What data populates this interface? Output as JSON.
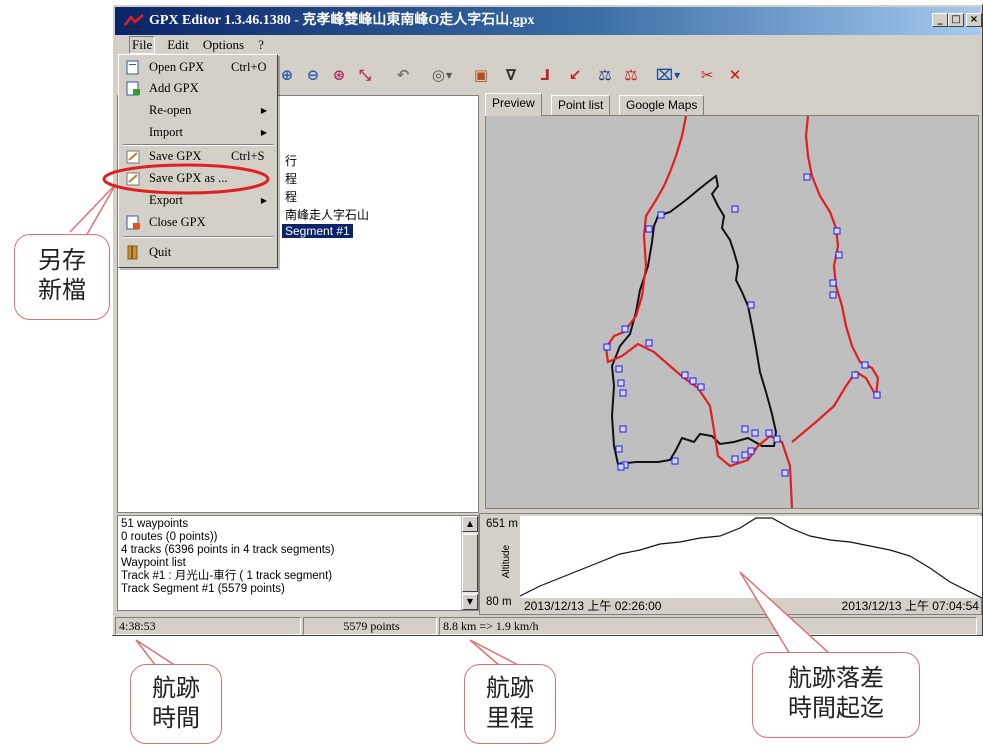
{
  "window": {
    "title": "GPX Editor 1.3.46.1380 - 克孝峰雙峰山東南峰O走人字石山.gpx",
    "controls": [
      "_",
      "□",
      "×"
    ]
  },
  "menubar": {
    "items": [
      "File",
      "Edit",
      "Options",
      "?"
    ]
  },
  "file_menu": {
    "items": [
      {
        "label": "Open GPX",
        "shortcut": "Ctrl+O",
        "icon": "open-file-icon"
      },
      {
        "label": "Add GPX",
        "shortcut": "",
        "icon": "add-file-icon"
      },
      {
        "label": "Re-open",
        "submenu": true
      },
      {
        "label": "Import",
        "submenu": true
      },
      {
        "label": "Save GPX",
        "shortcut": "Ctrl+S",
        "icon": "save-icon"
      },
      {
        "label": "Save GPX as ...",
        "shortcut": "",
        "icon": "save-as-icon"
      },
      {
        "label": "Export",
        "submenu": true
      },
      {
        "label": "Close GPX",
        "shortcut": "",
        "icon": "close-file-icon"
      },
      {
        "label": "Quit",
        "shortcut": "",
        "icon": "quit-icon"
      }
    ],
    "submenu_arrow": "▶"
  },
  "tree": {
    "items": [
      "行",
      "程",
      "程",
      "南峰走人字石山",
      "Segment #1"
    ]
  },
  "tabs": [
    "Preview",
    "Point list",
    "Google Maps"
  ],
  "info": {
    "lines": [
      "51 waypoints",
      "0 routes (0 points))",
      "4 tracks (6396 points in 4 track segments)",
      "Waypoint list",
      "Track #1 : 月光山-車行 ( 1 track segment)",
      "Track Segment #1 (5579 points)"
    ]
  },
  "altitude": {
    "max_label": "651 m",
    "min_label": "80 m",
    "axis_label": "Altitude",
    "start_time": "2013/12/13 上午 02:26:00",
    "end_time": "2013/12/13 上午 07:04:54"
  },
  "status": {
    "duration": "4:38:53",
    "points": "5579 points",
    "distance_speed": "8.8 km => 1.9 km/h"
  },
  "annotations": {
    "save_as": [
      "另存",
      "新檔"
    ],
    "track_time": [
      "航跡",
      "時間"
    ],
    "track_distance": [
      "航跡",
      "里程"
    ],
    "altitude_time": [
      "航跡落差",
      "時間起迄"
    ]
  },
  "colors": {
    "track_red": "#e02020",
    "track_black": "#111111",
    "waypoint": "#1a1aff",
    "highlight_ellipse": "#e02020",
    "callout_border": "#e07070"
  }
}
